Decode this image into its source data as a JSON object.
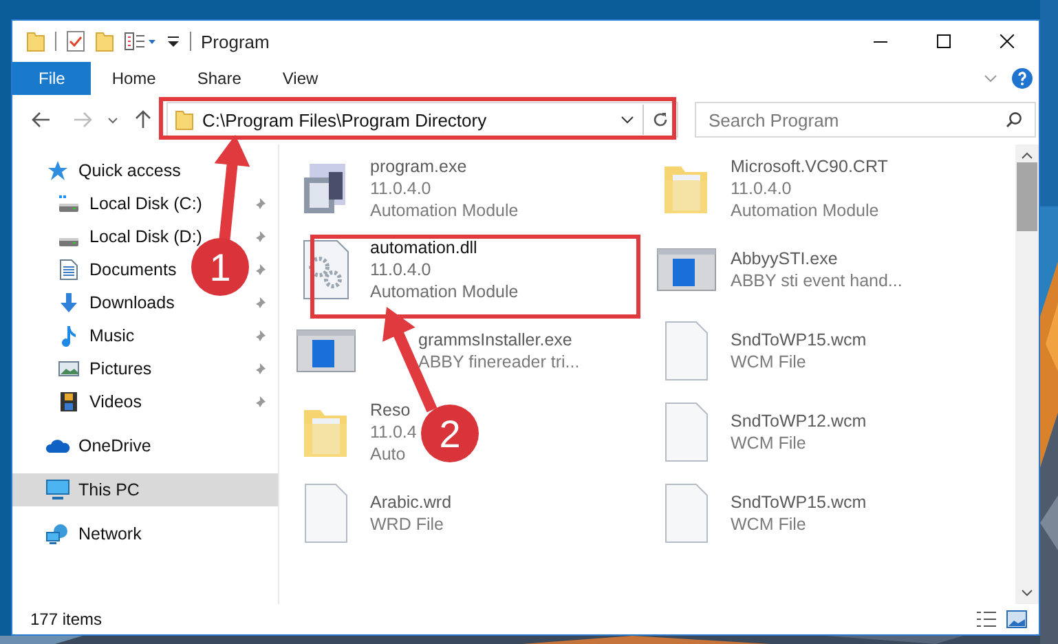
{
  "window": {
    "title": "Program"
  },
  "ribbon": {
    "tabs": [
      {
        "label": "File",
        "selected": true
      },
      {
        "label": "Home",
        "selected": false
      },
      {
        "label": "Share",
        "selected": false
      },
      {
        "label": "View",
        "selected": false
      }
    ]
  },
  "address": {
    "path": "C:\\Program Files\\Program Directory"
  },
  "search": {
    "placeholder": "Search Program"
  },
  "nav": {
    "items": [
      {
        "label": "Quick access",
        "kind": "star",
        "selected": false,
        "children": [
          {
            "label": "Local Disk (C:)",
            "kind": "disk-c",
            "pinned": true,
            "selected": false
          },
          {
            "label": "Local Disk (D:)",
            "kind": "disk",
            "pinned": true,
            "selected": false
          },
          {
            "label": "Documents",
            "kind": "documents",
            "pinned": true,
            "selected": false
          },
          {
            "label": "Downloads",
            "kind": "downloads",
            "pinned": true,
            "selected": false
          },
          {
            "label": "Music",
            "kind": "music",
            "pinned": true,
            "selected": false
          },
          {
            "label": "Pictures",
            "kind": "pictures",
            "pinned": true,
            "selected": false
          },
          {
            "label": "Videos",
            "kind": "videos",
            "pinned": true,
            "selected": false
          }
        ]
      },
      {
        "label": "OneDrive",
        "kind": "cloud",
        "selected": false
      },
      {
        "label": "This PC",
        "kind": "pc",
        "selected": true
      },
      {
        "label": "Network",
        "kind": "network",
        "selected": false
      }
    ]
  },
  "files": {
    "items": [
      {
        "name": "program.exe",
        "details": [
          "11.0.4.0",
          "Automation Module"
        ],
        "kind": "app",
        "blurred": true
      },
      {
        "name": "Microsoft.VC90.CRT",
        "details": [
          "11.0.4.0",
          "Automation Module"
        ],
        "kind": "folder",
        "blurred": true
      },
      {
        "name": "automation.dll",
        "details": [
          "11.0.4.0",
          "Automation Module"
        ],
        "kind": "dll",
        "blurred": false
      },
      {
        "name": "AbbyySTI.exe",
        "details": [
          "ABBY sti event hand..."
        ],
        "kind": "installer",
        "blurred": true
      },
      {
        "name": "grammsInstaller.exe",
        "details": [
          "ABBY finereader tri..."
        ],
        "kind": "installer",
        "blurred": true
      },
      {
        "name": "SndToWP15.wcm",
        "details": [
          "WCM File"
        ],
        "kind": "document",
        "blurred": true
      },
      {
        "name": "Reso",
        "details": [
          "11.0.4",
          "Auto"
        ],
        "kind": "folder",
        "blurred": true
      },
      {
        "name": "SndToWP12.wcm",
        "details": [
          "WCM File"
        ],
        "kind": "document",
        "blurred": true
      },
      {
        "name": "Arabic.wrd",
        "details": [
          "WRD File"
        ],
        "kind": "document",
        "blurred": true
      },
      {
        "name": "SndToWP15.wcm",
        "details": [
          "WCM File"
        ],
        "kind": "document",
        "blurred": true
      }
    ]
  },
  "status_bar": {
    "count": "177 items"
  },
  "annotations": {
    "markers": [
      {
        "number": "1"
      },
      {
        "number": "2"
      }
    ]
  }
}
